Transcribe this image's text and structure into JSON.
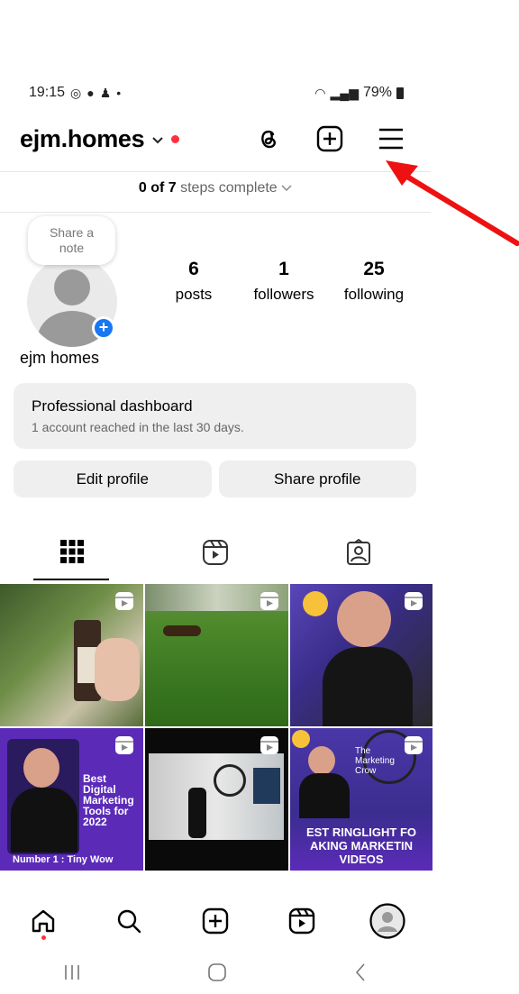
{
  "status_bar": {
    "time": "19:15",
    "battery": "79%"
  },
  "header": {
    "username": "ejm.homes"
  },
  "steps": {
    "prefix": "0 of 7",
    "suffix": "steps complete"
  },
  "profile": {
    "note_text": "Share a note",
    "display_name": "ejm homes",
    "stats": [
      {
        "value": "6",
        "label": "posts"
      },
      {
        "value": "1",
        "label": "followers"
      },
      {
        "value": "25",
        "label": "following"
      }
    ]
  },
  "dashboard": {
    "title": "Professional dashboard",
    "subtitle": "1 account reached in the last 30 days."
  },
  "buttons": {
    "edit": "Edit profile",
    "share": "Share profile"
  },
  "posts": {
    "post4_lines": [
      "Best",
      "Digital",
      "Marketing",
      "Tools for",
      "2022"
    ],
    "post4_caption": "Number 1 : Tiny Wow",
    "post6_lines": [
      "EST RINGLIGHT FO",
      "AKING MARKETIN",
      "VIDEOS"
    ],
    "post6_brand": "The Marketing Crow"
  },
  "colors": {
    "accent": "#1877f2",
    "notification": "#ff3040",
    "arrow": "#ee1111"
  }
}
